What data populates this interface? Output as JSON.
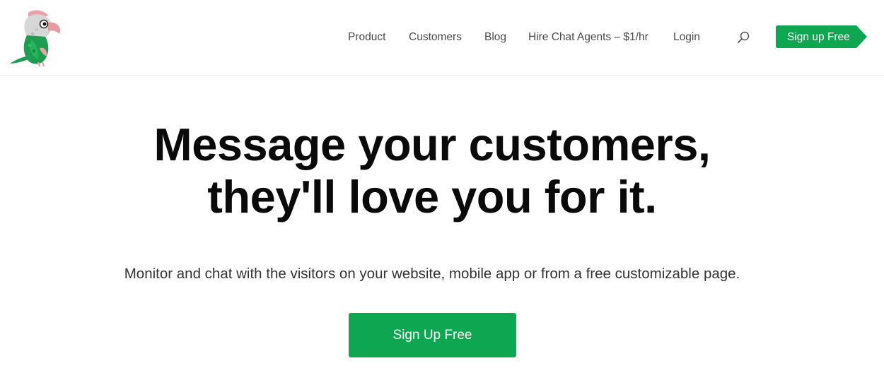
{
  "brand": {
    "logo_icon": "parrot-logo-icon",
    "accent_color": "#0fa652"
  },
  "nav": {
    "items": [
      {
        "label": "Product"
      },
      {
        "label": "Customers"
      },
      {
        "label": "Blog"
      },
      {
        "label": "Hire Chat Agents – $1/hr"
      },
      {
        "label": "Login"
      }
    ],
    "search_icon": "search-icon",
    "signup_label": "Sign up Free"
  },
  "hero": {
    "title_line1": "Message your customers,",
    "title_line2": "they'll love you for it.",
    "subtitle": "Monitor and chat with the visitors on your website, mobile app or from a free customizable page.",
    "cta_label": "Sign Up Free"
  }
}
